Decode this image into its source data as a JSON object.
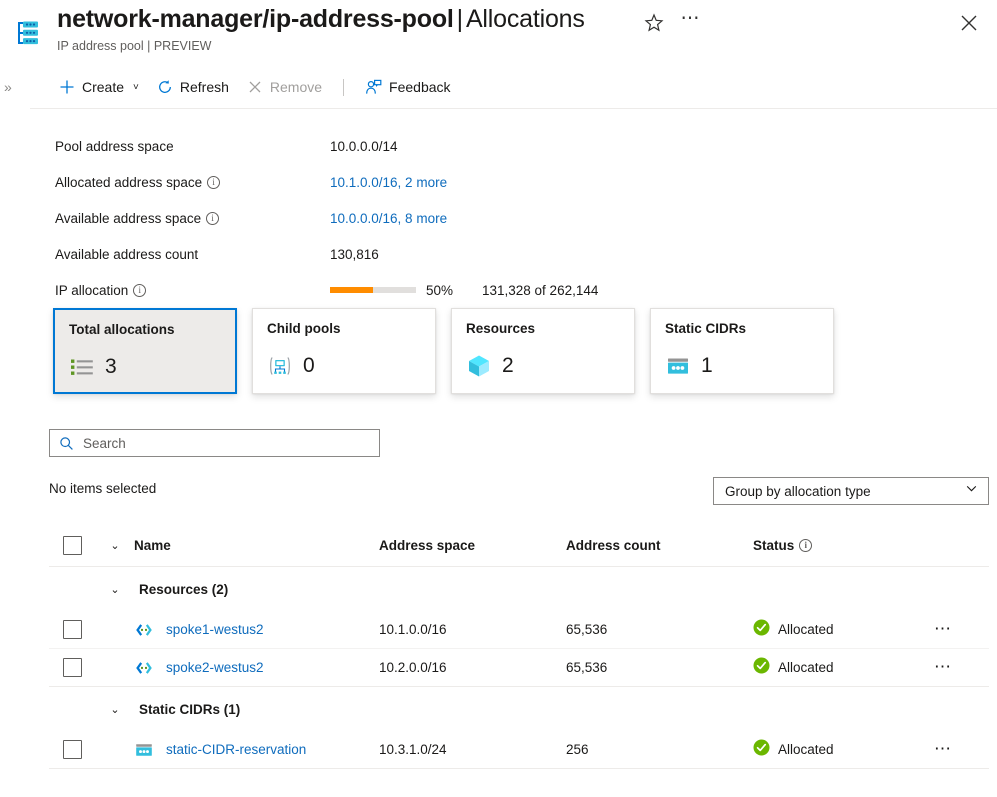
{
  "header": {
    "icon": "ip-address-pool-icon",
    "title_main": "network-manager/ip-address-pool",
    "title_sep": "|",
    "title_sub": "Allocations",
    "subtitle": "IP address pool | PREVIEW",
    "favorite_icon": "star-icon",
    "more_icon": "ellipsis-icon",
    "close_icon": "close-icon"
  },
  "toolbar": {
    "expand_icon": "double-chevron-right-icon",
    "create_label": "Create",
    "refresh_label": "Refresh",
    "remove_label": "Remove",
    "feedback_label": "Feedback"
  },
  "properties": [
    {
      "label": "Pool address space",
      "value": "10.0.0.0/14",
      "info": false,
      "link": false
    },
    {
      "label": "Allocated address space",
      "value": "10.1.0.0/16, 2 more",
      "info": true,
      "link": true
    },
    {
      "label": "Available address space",
      "value": "10.0.0.0/16, 8 more",
      "info": true,
      "link": true
    },
    {
      "label": "Available address count",
      "value": "130,816",
      "info": false,
      "link": false
    }
  ],
  "ip_allocation": {
    "label": "IP allocation",
    "percent_text": "50%",
    "percent_value": 50,
    "count_text": "131,328 of 262,144",
    "bar_color": "#ff8c00",
    "track_color": "#e1dfdd"
  },
  "tiles": [
    {
      "title": "Total allocations",
      "count": "3",
      "icon": "list-icon",
      "selected": true
    },
    {
      "title": "Child pools",
      "count": "0",
      "icon": "child-pool-icon",
      "selected": false
    },
    {
      "title": "Resources",
      "count": "2",
      "icon": "resource-cube-icon",
      "selected": false
    },
    {
      "title": "Static CIDRs",
      "count": "1",
      "icon": "static-cidr-icon",
      "selected": false
    }
  ],
  "search": {
    "placeholder": "Search",
    "value": "",
    "icon": "search-icon"
  },
  "selection_status": "No items selected",
  "group_by": {
    "selected": "Group by allocation type",
    "chevron": "chevron-down-icon"
  },
  "table": {
    "columns": {
      "name": "Name",
      "address_space": "Address space",
      "address_count": "Address count",
      "status": "Status"
    },
    "status_has_info": true,
    "groups": [
      {
        "label": "Resources (2)",
        "rows": [
          {
            "name": "spoke1-westus2",
            "icon": "virtual-network-icon",
            "address_space": "10.1.0.0/16",
            "address_count": "65,536",
            "status": "Allocated",
            "status_icon": "success-check-icon",
            "more": "⋯"
          },
          {
            "name": "spoke2-westus2",
            "icon": "virtual-network-icon",
            "address_space": "10.2.0.0/16",
            "address_count": "65,536",
            "status": "Allocated",
            "status_icon": "success-check-icon",
            "more": "⋯"
          }
        ]
      },
      {
        "label": "Static CIDRs (1)",
        "rows": [
          {
            "name": "static-CIDR-reservation",
            "icon": "static-cidr-icon",
            "address_space": "10.3.1.0/24",
            "address_count": "256",
            "status": "Allocated",
            "status_icon": "success-check-icon",
            "more": "⋯"
          }
        ]
      }
    ]
  },
  "colors": {
    "accent": "#0078d4",
    "link": "#0f6cbd",
    "success": "#6bb700",
    "warning_bar": "#ff8c00"
  }
}
